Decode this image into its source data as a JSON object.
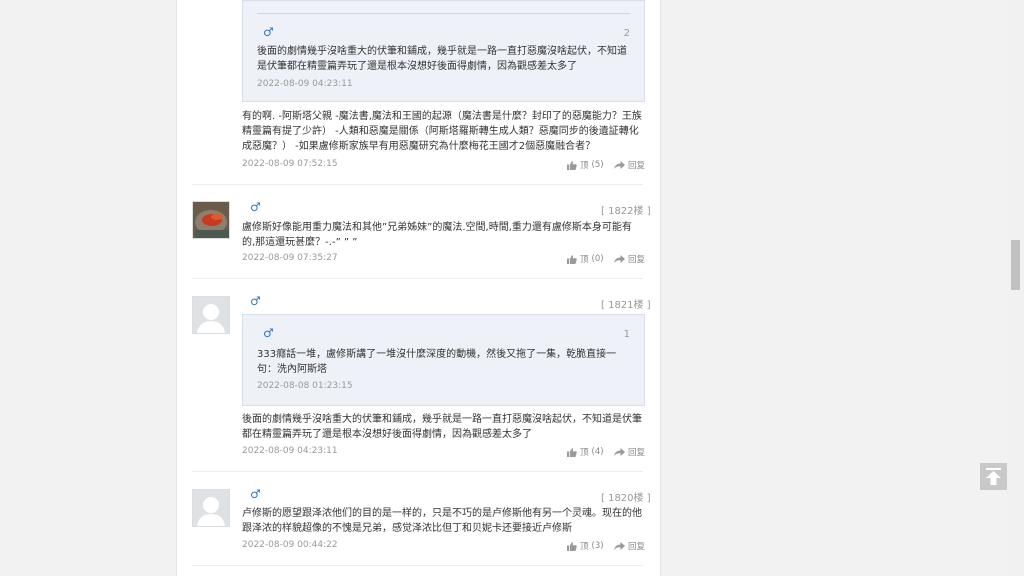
{
  "actions": {
    "like_label": "顶",
    "reply_label": "回复"
  },
  "thread": {
    "quote_top": {
      "number": "2",
      "text": "後面的劇情幾乎沒啥重大的伏筆和鋪成，幾乎就是一路一直打惡魔沒啥起伏，不知道是伏筆都在精靈篇弄玩了還是根本沒想好後面得劇情，因為觀感差太多了",
      "time": "2022-08-09 04:23:11"
    },
    "reply_top": {
      "text": "有的啊. -阿斯塔父親 -魔法書,魔法和王國的起源（魔法書是什麼？封印了的惡魔能力？王族精靈篇有提了少許） -人類和惡魔是關係（阿斯塔羅斯轉生成人類？惡魔同步的後遺証轉化成惡魔？） -如果盧修斯家族早有用惡魔研究為什麼梅花王國才2個惡魔融合者？",
      "time": "2022-08-09 07:52:15",
      "likes": "(5)"
    },
    "posts": [
      {
        "floor": "[ 1822楼 ]",
        "text": "盧修斯好像能用重力魔法和其他”兄弟姊妹”的魔法.空間,時間,重力還有盧修斯本身可能有的,那這還玩甚麼？-.-” ” ”",
        "time": "2022-08-09 07:35:27",
        "likes": "(0)"
      },
      {
        "floor": "[ 1821楼 ]",
        "quote": {
          "number": "1",
          "text": "333癮話一堆，盧修斯講了一堆沒什麼深度的動機，然後又拖了一集，乾脆直接一句：洗內阿斯塔",
          "time": "2022-08-08 01:23:15"
        },
        "text": "後面的劇情幾乎沒啥重大的伏筆和鋪成，幾乎就是一路一直打惡魔沒啥起伏，不知道是伏筆都在精靈篇弄玩了還是根本沒想好後面得劇情，因為觀感差太多了",
        "time": "2022-08-09 04:23:11",
        "likes": "(4)"
      },
      {
        "floor": "[ 1820楼 ]",
        "text": "卢修斯的愿望跟泽浓他们的目的是一样的，只是不巧的是卢修斯他有另一个灵魂。现在的他跟泽浓的样貌超像的不愧是兄弟，感觉泽浓比但丁和贝妮卡还要接近卢修斯",
        "time": "2022-08-09 00:44:22",
        "likes": "(3)"
      }
    ]
  },
  "colors": {
    "male_icon": "#2f78c4",
    "meta_gray": "#999999",
    "quote_bg": "#eef2f8"
  }
}
